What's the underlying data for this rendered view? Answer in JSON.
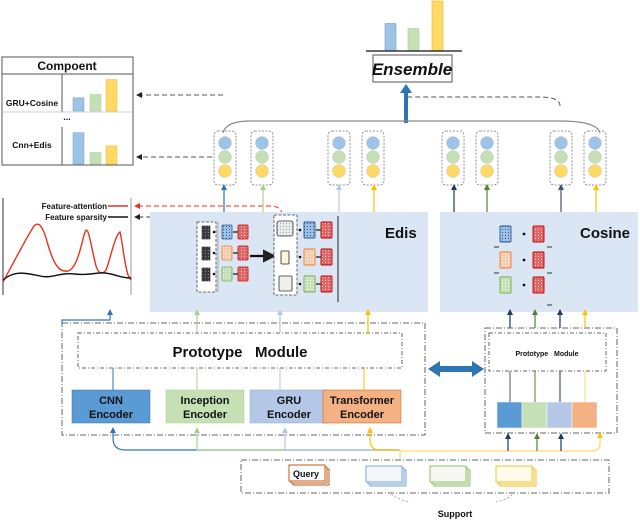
{
  "ensemble": {
    "label": "Ensemble",
    "bars": [
      0.55,
      0.45,
      1.0
    ]
  },
  "component_table": {
    "title": "Compoent",
    "rows": [
      {
        "label": "GRU+Cosine",
        "bars": [
          0.4,
          0.5,
          0.95
        ]
      },
      {
        "label": "...",
        "bars": []
      },
      {
        "label": "Cnn+Edis",
        "bars": [
          0.95,
          0.35,
          0.55
        ]
      }
    ]
  },
  "feature_plot": {
    "legend": [
      {
        "label": "Feature-attention",
        "color": "#e8321e"
      },
      {
        "label": "Feature sparsity",
        "color": "#111111"
      }
    ]
  },
  "edis_panel": {
    "title": "Edis"
  },
  "cosine_panel": {
    "title": "Cosine"
  },
  "prototype_module": {
    "label": "Prototype   Module",
    "small_label": "Prototype   Module"
  },
  "encoders": [
    {
      "line1": "CNN",
      "line2": "Encoder",
      "color": "#5b9bd5"
    },
    {
      "line1": "Inception",
      "line2": "Encoder",
      "color": "#c5e0b4"
    },
    {
      "line1": "GRU",
      "line2": "Encoder",
      "color": "#b4c7e7"
    },
    {
      "line1": "Transformer",
      "line2": "Encoder",
      "color": "#f4b183"
    }
  ],
  "inputs": {
    "query_label": "Query",
    "support_label": "Support"
  },
  "colors": {
    "blue": "#9dc3e6",
    "green": "#c5e0b4",
    "yellow": "#ffd966",
    "panel_bg": "#dae6f3",
    "arrow_blue": "#2e75b6"
  }
}
